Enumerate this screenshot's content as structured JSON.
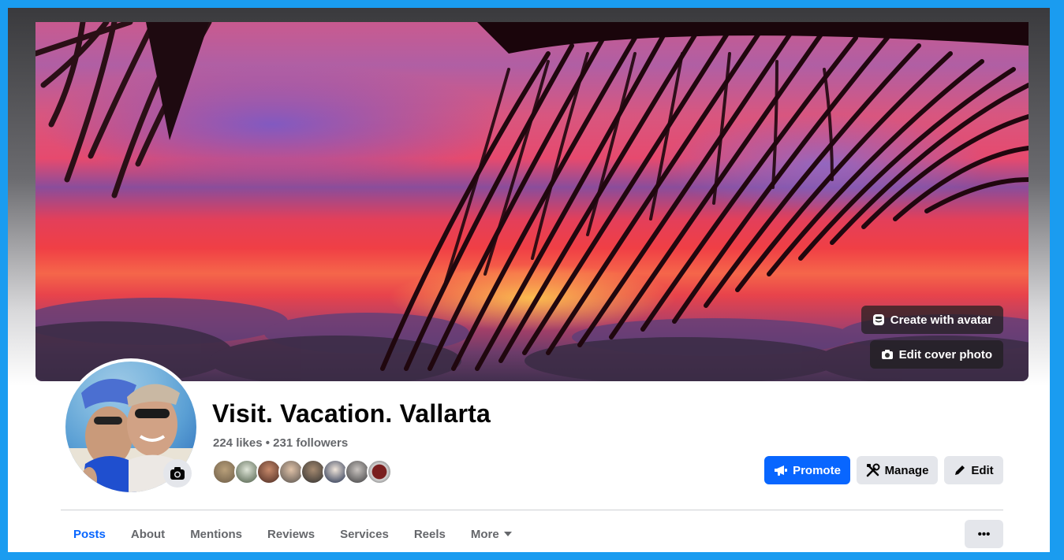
{
  "page": {
    "name": "Visit. Vacation. Vallarta",
    "stats": "224 likes • 231 followers"
  },
  "cover": {
    "create_avatar_label": "Create with avatar",
    "edit_cover_label": "Edit cover photo"
  },
  "actions": {
    "promote_label": "Promote",
    "manage_label": "Manage",
    "edit_label": "Edit"
  },
  "tabs": [
    {
      "label": "Posts",
      "active": true
    },
    {
      "label": "About"
    },
    {
      "label": "Mentions"
    },
    {
      "label": "Reviews"
    },
    {
      "label": "Services"
    },
    {
      "label": "Reels"
    },
    {
      "label": "More"
    }
  ],
  "more_options_label": "•••",
  "colors": {
    "primary": "#0866ff",
    "secondary_button": "#e4e6eb",
    "text_secondary": "#65676b",
    "frame_border": "#1a9cf0"
  },
  "icons": {
    "avatar": "avatar-icon",
    "camera": "camera-icon",
    "megaphone": "megaphone-icon",
    "tools": "tools-icon",
    "pencil": "pencil-icon",
    "caret": "caret-down-icon"
  }
}
